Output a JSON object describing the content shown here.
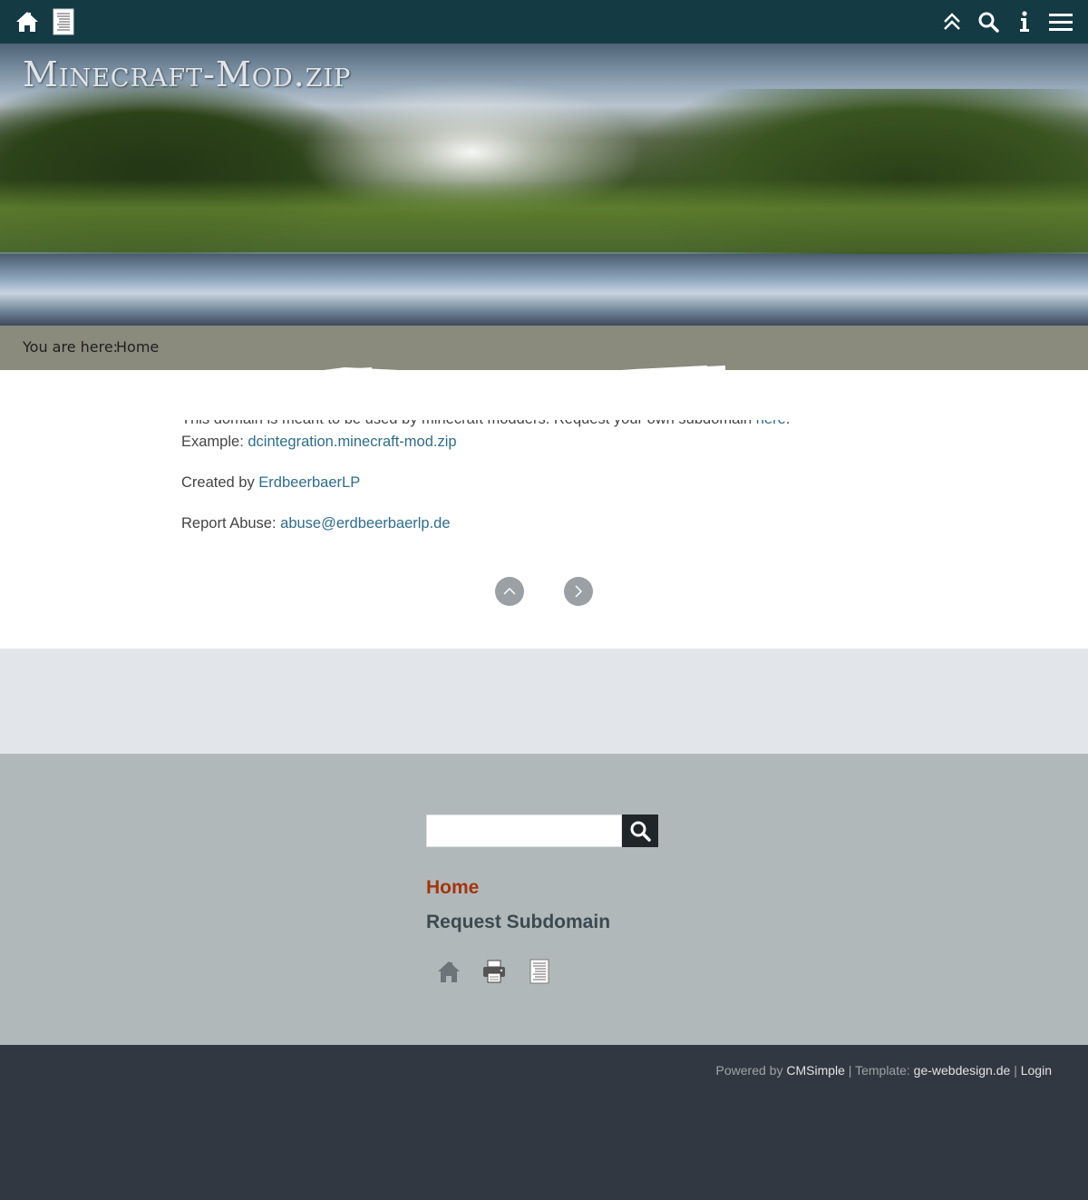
{
  "topbar": {
    "home_icon": "home-icon",
    "sitemap_icon": "sitemap-icon",
    "top_icon": "double-chevron-up-icon",
    "search_icon": "search-icon",
    "info_icon": "info-icon",
    "menu_icon": "hamburger-menu-icon",
    "bg_color": "#143a44"
  },
  "header": {
    "site_title": "Minecraft-Mod.zip"
  },
  "breadcrumb": {
    "label": "You are here:",
    "current": "Home"
  },
  "content": {
    "intro_text": "This domain is meant to be used by minecraft modders. Request your own subdomain ",
    "intro_link": "here",
    "intro_end": ".",
    "example_label": "Example: ",
    "example_link": "dcintegration.minecraft-mod.zip",
    "created_label": "Created by ",
    "created_link": "ErdbeerbaerLP",
    "abuse_label": "Report Abuse: ",
    "abuse_link": "abuse@erdbeerbaerlp.de",
    "nav_up_icon": "chevron-up-icon",
    "nav_next_icon": "chevron-right-icon"
  },
  "sidebar": {
    "search_placeholder": "",
    "search_value": "",
    "menu": [
      {
        "label": "Home",
        "active": true
      },
      {
        "label": "Request Subdomain",
        "active": false
      }
    ],
    "icons": [
      "home-icon",
      "print-icon",
      "sitemap-icon"
    ],
    "active_color": "#a3350f"
  },
  "footer": {
    "powered_by": "Powered by ",
    "cms_link": "CMSimple",
    "template_label": " | Template: ",
    "template_link": "ge-webdesign.de",
    "separator": " | ",
    "login_link": "Login"
  }
}
